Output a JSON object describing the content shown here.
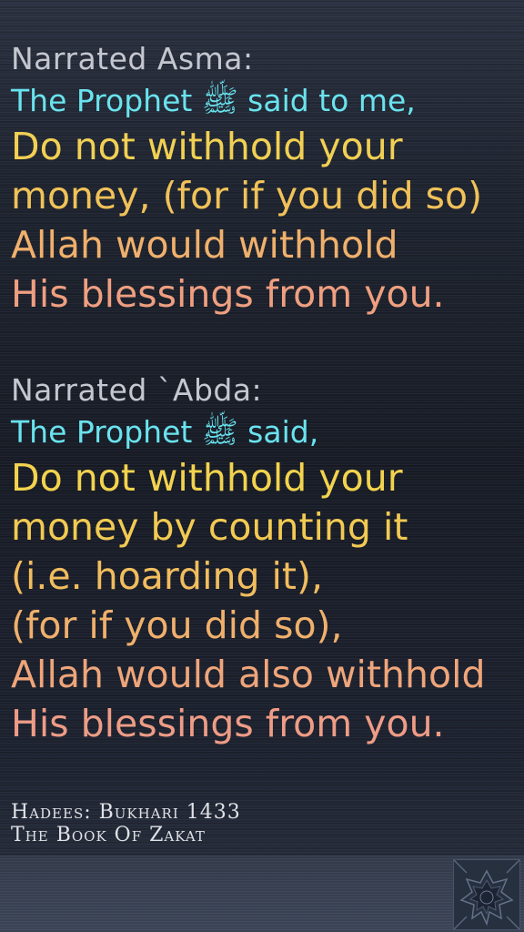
{
  "hadith1": {
    "narrator": "Narrated Asma:",
    "intro": "The Prophet ﷺ said to me,",
    "lines": [
      "Do not withhold your",
      "money, (for if you did so)",
      "Allah would withhold",
      "His blessings from you."
    ]
  },
  "hadith2": {
    "narrator": "Narrated `Abda:",
    "intro": "The Prophet ﷺ said,",
    "lines": [
      "Do not withhold your",
      "money by counting it",
      "(i.e. hoarding it),",
      "(for if you did so),",
      "Allah would also withhold",
      "His blessings from you."
    ]
  },
  "footer": {
    "reference": "Hadees: Bukhari 1433",
    "book": "The Book Of Zakat"
  },
  "colors": {
    "narrator": "#c4c7cf",
    "intro": "#69e3ee",
    "gradient_top": "#f1d053",
    "gradient_bottom": "#ef9c84"
  },
  "icons": {
    "emblem": "islamic-star-pattern-icon"
  }
}
